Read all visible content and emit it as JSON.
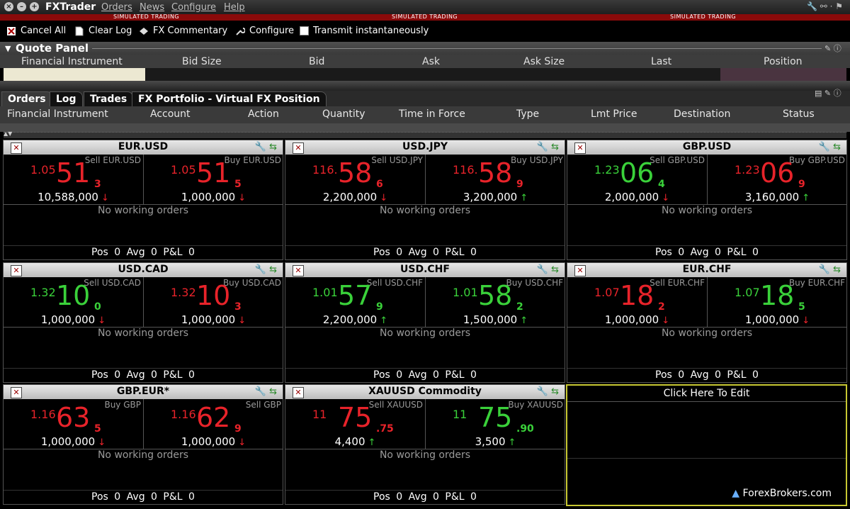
{
  "titlebar": {
    "app_title": "FXTrader",
    "menus": [
      "Orders",
      "News",
      "Configure",
      "Help"
    ],
    "simulated": "SIMULATED TRADING"
  },
  "toolbar": {
    "cancel_all": "Cancel All",
    "clear_log": "Clear Log",
    "fx_commentary": "FX Commentary",
    "configure": "Configure",
    "transmit": "Transmit instantaneously"
  },
  "quote_panel": {
    "title": "Quote Panel",
    "columns": [
      "Financial Instrument",
      "Bid Size",
      "Bid",
      "Ask",
      "Ask Size",
      "Last",
      "Position"
    ]
  },
  "orders": {
    "tabs": [
      "Orders",
      "Log",
      "Trades",
      "FX Portfolio - Virtual FX Position"
    ],
    "columns": [
      "Financial Instrument",
      "Account",
      "Action",
      "Quantity",
      "Time in Force",
      "Type",
      "Lmt Price",
      "Destination",
      "Status"
    ]
  },
  "tiles": [
    {
      "title": "EUR.USD",
      "left": {
        "label": "Sell EUR.USD",
        "prefix": "1.05",
        "main": "51",
        "pip": "3",
        "color": "red",
        "size": "10,588,000",
        "arrow": "↓",
        "arrow_color": "red"
      },
      "right": {
        "label": "Buy EUR.USD",
        "prefix": "1.05",
        "main": "51",
        "pip": "5",
        "color": "red",
        "size": "1,000,000",
        "arrow": "↓",
        "arrow_color": "red"
      },
      "status": "No working orders",
      "pos": "Pos 0",
      "avg": "Avg 0",
      "pnl": "P&L 0"
    },
    {
      "title": "USD.JPY",
      "left": {
        "label": "Sell USD.JPY",
        "prefix": "116.",
        "main": "58",
        "pip": "6",
        "color": "red",
        "size": "2,200,000",
        "arrow": "↓",
        "arrow_color": "red"
      },
      "right": {
        "label": "Buy USD.JPY",
        "prefix": "116.",
        "main": "58",
        "pip": "9",
        "color": "red",
        "size": "3,200,000",
        "arrow": "↑",
        "arrow_color": "green"
      },
      "status": "No working orders",
      "pos": "Pos 0",
      "avg": "Avg 0",
      "pnl": "P&L 0"
    },
    {
      "title": "GBP.USD",
      "left": {
        "label": "Sell GBP.USD",
        "prefix": "1.23",
        "main": "06",
        "pip": "4",
        "color": "green",
        "size": "2,000,000",
        "arrow": "↓",
        "arrow_color": "red"
      },
      "right": {
        "label": "Buy GBP.USD",
        "prefix": "1.23",
        "main": "06",
        "pip": "9",
        "color": "red",
        "size": "3,160,000",
        "arrow": "↑",
        "arrow_color": "green"
      },
      "status": "No working orders",
      "pos": "Pos 0",
      "avg": "Avg 0",
      "pnl": "P&L 0"
    },
    {
      "title": "USD.CAD",
      "left": {
        "label": "Sell USD.CAD",
        "prefix": "1.32",
        "main": "10",
        "pip": "0",
        "color": "green",
        "size": "1,000,000",
        "arrow": "↓",
        "arrow_color": "red"
      },
      "right": {
        "label": "Buy USD.CAD",
        "prefix": "1.32",
        "main": "10",
        "pip": "3",
        "color": "red",
        "size": "1,000,000",
        "arrow": "↓",
        "arrow_color": "red"
      },
      "status": "No working orders",
      "pos": "Pos 0",
      "avg": "Avg 0",
      "pnl": "P&L 0"
    },
    {
      "title": "USD.CHF",
      "left": {
        "label": "Sell USD.CHF",
        "prefix": "1.01",
        "main": "57",
        "pip": "9",
        "color": "green",
        "size": "2,200,000",
        "arrow": "↑",
        "arrow_color": "green"
      },
      "right": {
        "label": "Buy USD.CHF",
        "prefix": "1.01",
        "main": "58",
        "pip": "2",
        "color": "green",
        "size": "1,500,000",
        "arrow": "↑",
        "arrow_color": "green"
      },
      "status": "No working orders",
      "pos": "Pos 0",
      "avg": "Avg 0",
      "pnl": "P&L 0"
    },
    {
      "title": "EUR.CHF",
      "left": {
        "label": "Sell EUR.CHF",
        "prefix": "1.07",
        "main": "18",
        "pip": "2",
        "color": "red",
        "size": "1,000,000",
        "arrow": "↓",
        "arrow_color": "red"
      },
      "right": {
        "label": "Buy EUR.CHF",
        "prefix": "1.07",
        "main": "18",
        "pip": "5",
        "color": "green",
        "size": "1,000,000",
        "arrow": "↓",
        "arrow_color": "red"
      },
      "status": "No working orders",
      "pos": "Pos 0",
      "avg": "Avg 0",
      "pnl": "P&L 0"
    },
    {
      "title": "GBP.EUR*",
      "left": {
        "label": "Buy GBP",
        "prefix": "1.16",
        "main": "63",
        "pip": "5",
        "color": "red",
        "size": "1,000,000",
        "arrow": "↓",
        "arrow_color": "red"
      },
      "right": {
        "label": "Sell GBP",
        "prefix": "1.16",
        "main": "62",
        "pip": "9",
        "color": "red",
        "size": "1,000,000",
        "arrow": "↓",
        "arrow_color": "red"
      },
      "status": "No working orders",
      "pos": "Pos 0",
      "avg": "Avg 0",
      "pnl": "P&L 0"
    },
    {
      "title": "XAUUSD Commodity",
      "left": {
        "label": "Sell XAUUSD",
        "prefix": "11",
        "main": "75",
        "pip": ".75",
        "color": "red",
        "size": "4,400",
        "arrow": "↑",
        "arrow_color": "green"
      },
      "right": {
        "label": "Buy XAUUSD",
        "prefix": "11",
        "main": "75",
        "pip": ".90",
        "color": "green",
        "size": "3,500",
        "arrow": "↑",
        "arrow_color": "green"
      },
      "status": "No working orders",
      "pos": "Pos 0",
      "avg": "Avg 0",
      "pnl": "P&L 0"
    }
  ],
  "empty_tile": {
    "label": "Click Here To Edit",
    "brand": "ForexBrokers.com"
  },
  "colors": {
    "red": "#e8232a",
    "green": "#3ad13a",
    "sim_bar": "#8a0a0a",
    "edit_border": "#c8c832"
  }
}
